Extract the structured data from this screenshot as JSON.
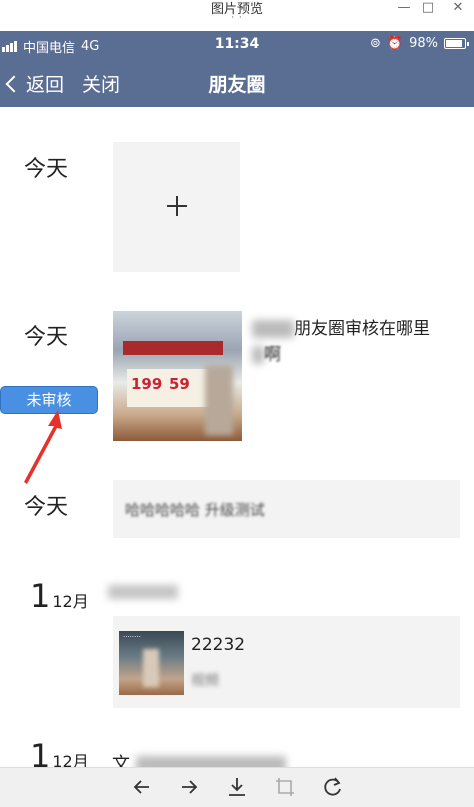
{
  "viewer": {
    "title": "图片预览",
    "subtitle": "· ·"
  },
  "status": {
    "carrier": "中国电信",
    "network": "4G",
    "time": "11:34",
    "battery": "98%"
  },
  "nav": {
    "back_label": "返回",
    "close_label": "关闭",
    "title": "朋友圈"
  },
  "timeline": {
    "day1": "今天",
    "day2": "今天",
    "day3": "今天",
    "day4_num": "1",
    "day4_month": "12月",
    "day5_num": "1",
    "day5_month": "12月",
    "post2_text": "朋友圈审核在哪里",
    "post2_text2": "啊",
    "post3_text": "哈哈哈哈哈 升级测试",
    "post4_code": "22232",
    "post4_sub": "视频",
    "post5_text": "文"
  },
  "badge": {
    "label": "未审核",
    "color": "#4a90e2"
  },
  "colors": {
    "nav_bg": "#5a6d92",
    "arrow": "#e8302a"
  },
  "toolbar": {
    "icons": [
      "arrow-left-icon",
      "arrow-right-icon",
      "download-icon",
      "crop-icon",
      "rotate-icon"
    ]
  }
}
